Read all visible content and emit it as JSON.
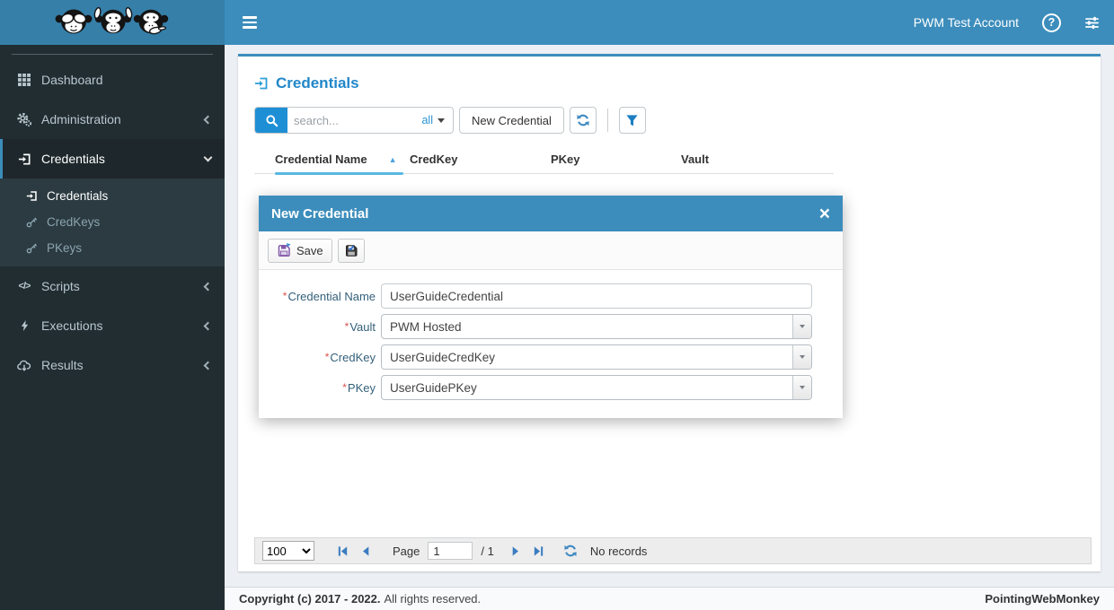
{
  "colors": {
    "navbar": "#3c8dbc",
    "logo_bg": "#367fa9",
    "sidebar": "#222d32",
    "sidebar_active_bg": "#1e282c",
    "submenu_bg": "#2c3b41",
    "accent_heading": "#2187c9",
    "search_button": "#1e8fd5",
    "sort_underline": "#57b8e2",
    "content_bg": "#ecf0f5",
    "required": "#d9534f"
  },
  "icons": {
    "help": "?",
    "close": "×",
    "code": "</>",
    "sort_asc": "▲"
  },
  "navbar": {
    "account": "PWM Test Account"
  },
  "sidebar": {
    "items": [
      {
        "label": "Dashboard"
      },
      {
        "label": "Administration"
      },
      {
        "label": "Credentials"
      },
      {
        "label": "Scripts"
      },
      {
        "label": "Executions"
      },
      {
        "label": "Results"
      }
    ],
    "credentials_children": [
      {
        "label": "Credentials"
      },
      {
        "label": "CredKeys"
      },
      {
        "label": "PKeys"
      }
    ]
  },
  "page": {
    "title": "Credentials"
  },
  "toolbar": {
    "search_placeholder": "search...",
    "search_scope": "all",
    "new_button": "New Credential"
  },
  "table": {
    "columns": [
      "Credential Name",
      "CredKey",
      "PKey",
      "Vault"
    ],
    "sorted_by": "Credential Name",
    "sort_direction": "asc"
  },
  "modal": {
    "title": "New Credential",
    "save_label": "Save",
    "required_marker": "*",
    "fields": [
      {
        "label": "Credential Name",
        "value": "UserGuideCredential",
        "type": "text"
      },
      {
        "label": "Vault",
        "value": "PWM Hosted",
        "type": "select"
      },
      {
        "label": "CredKey",
        "value": "UserGuideCredKey",
        "type": "select"
      },
      {
        "label": "PKey",
        "value": "UserGuidePKey",
        "type": "select"
      }
    ]
  },
  "pagination": {
    "page_size": "100",
    "page_label": "Page",
    "current_page": "1",
    "of_pages": "/ 1",
    "status": "No records"
  },
  "footer": {
    "copyright": "Copyright (c) 2017 - 2022.",
    "rights": "All rights reserved.",
    "brand": "PointingWebMonkey"
  }
}
